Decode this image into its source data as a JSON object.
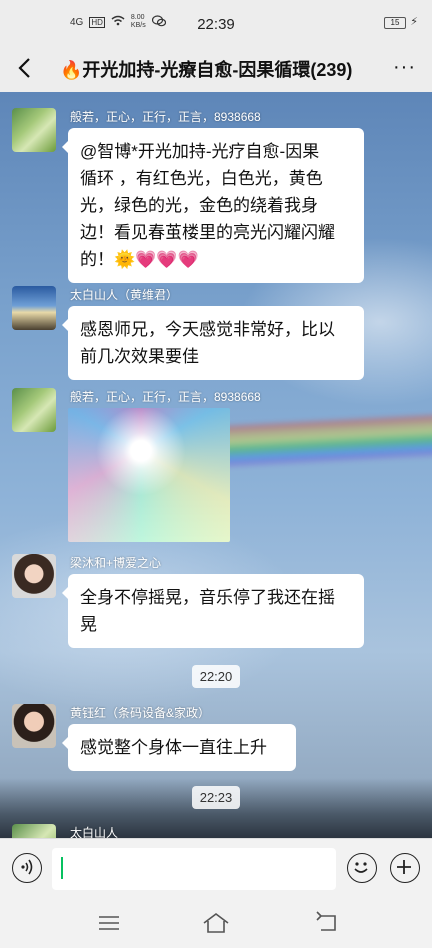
{
  "status": {
    "network": "4G",
    "hd": "HD",
    "speed_value": "8.00",
    "speed_unit": "KB/s",
    "time": "22:39",
    "battery": "15"
  },
  "header": {
    "title": "🔥开光加持-光療自愈-因果循環(239)"
  },
  "messages": [
    {
      "sender": "般若，正心，正行，正言，8938668",
      "text_lines": [
        "@智博*开光加持-光疗自愈-因果",
        "循环 ，有红色光，白色光，黄色",
        "光，绿色的光，金色的绕着我身",
        "边！看见春茧楼里的亮光闪耀闪耀",
        "的！🌞💗💗💗"
      ]
    },
    {
      "sender": "太白山人（黄维君）",
      "text_lines": [
        "感恩师兄，今天感觉非常好，比以",
        "前几次效果要佳"
      ]
    },
    {
      "sender": "般若，正心，正行，正言，8938668",
      "image": "rainbow-light-photo"
    },
    {
      "sender": "梁沐和+博爱之心",
      "text_lines": [
        "全身不停摇晃，音乐停了我还在摇",
        "晃"
      ]
    },
    {
      "sender": "黄钰红（条码设备&家政）",
      "text_lines": [
        "感觉整个身体一直往上升"
      ]
    },
    {
      "sender": "太白山人"
    }
  ],
  "timestamps": [
    "22:20",
    "22:23"
  ],
  "input": {
    "placeholder": ""
  },
  "icons": {
    "back": "chevron-left-icon",
    "more": "more-dots-icon",
    "voice": "voice-icon",
    "emoji": "emoji-icon",
    "plus": "plus-icon",
    "nav_menu": "menu-icon",
    "nav_home": "home-icon",
    "nav_back": "back-icon"
  },
  "colors": {
    "accent": "#07c160",
    "bubble": "#ffffff"
  }
}
